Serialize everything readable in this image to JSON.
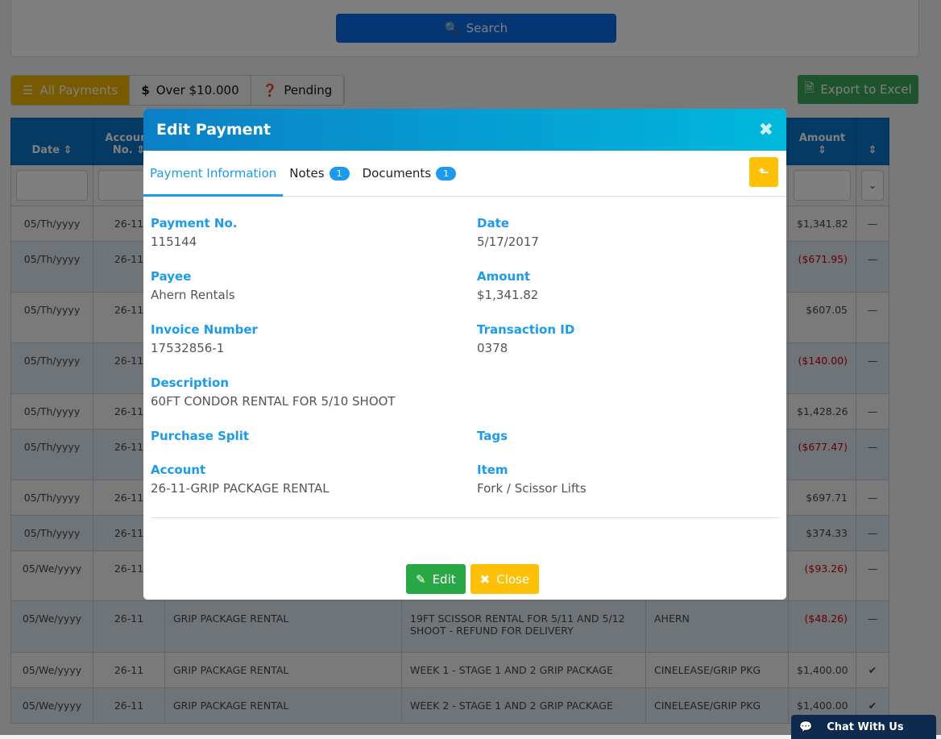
{
  "search": {
    "label": "Search"
  },
  "filters": [
    {
      "label": "All Payments",
      "icon": "list-icon"
    },
    {
      "label": "Over $10.000",
      "icon": "dollar-icon"
    },
    {
      "label": "Pending",
      "icon": "question-icon"
    }
  ],
  "export_label": "Export to Excel",
  "table": {
    "headers": {
      "date": "Date",
      "account": "Account No.",
      "amount": "Amount"
    },
    "rows": [
      {
        "date": "05/Th/yyyy",
        "acct": "26-11",
        "desc": "",
        "memo": "",
        "vendor": "",
        "amount": "$1,341.82",
        "neg": false,
        "status": "dash"
      },
      {
        "date": "05/Th/yyyy",
        "acct": "26-11",
        "desc": "",
        "memo": "",
        "vendor": "",
        "amount": "($671.95)",
        "neg": true,
        "status": "dash"
      },
      {
        "date": "05/Th/yyyy",
        "acct": "26-11",
        "desc": "",
        "memo": "",
        "vendor": "",
        "amount": "$607.05",
        "neg": false,
        "status": "dash"
      },
      {
        "date": "05/Th/yyyy",
        "acct": "26-11",
        "desc": "",
        "memo": "",
        "vendor": "",
        "amount": "($140.00)",
        "neg": true,
        "status": "dash"
      },
      {
        "date": "05/Th/yyyy",
        "acct": "26-11",
        "desc": "",
        "memo": "",
        "vendor": "",
        "amount": "$1,428.26",
        "neg": false,
        "status": "dash"
      },
      {
        "date": "05/Th/yyyy",
        "acct": "26-11",
        "desc": "",
        "memo": "",
        "vendor": "",
        "amount": "($677.47)",
        "neg": true,
        "status": "dash"
      },
      {
        "date": "05/Th/yyyy",
        "acct": "26-11",
        "desc": "",
        "memo": "",
        "vendor": "",
        "amount": "$697.71",
        "neg": false,
        "status": "dash"
      },
      {
        "date": "05/Th/yyyy",
        "acct": "26-11",
        "desc": "",
        "memo": "",
        "vendor": "",
        "amount": "$374.33",
        "neg": false,
        "status": "dash"
      },
      {
        "date": "05/We/yyyy",
        "acct": "26-11",
        "desc": "",
        "memo": "",
        "vendor": "",
        "amount": "($93.26)",
        "neg": true,
        "status": "dash"
      },
      {
        "date": "05/We/yyyy",
        "acct": "26-11",
        "desc": "GRIP PACKAGE RENTAL",
        "memo": "19FT SCISSOR RENTAL FOR 5/11 AND 5/12 SHOOT - REFUND FOR DELIVERY",
        "vendor": "AHERN",
        "amount": "($48.26)",
        "neg": true,
        "status": "dash"
      },
      {
        "date": "05/We/yyyy",
        "acct": "26-11",
        "desc": "GRIP PACKAGE RENTAL",
        "memo": "WEEK 1 - STAGE 1 AND 2 GRIP PACKAGE",
        "vendor": "CINELEASE/GRIP PKG",
        "amount": "$1,400.00",
        "neg": false,
        "status": "check"
      },
      {
        "date": "05/We/yyyy",
        "acct": "26-11",
        "desc": "GRIP PACKAGE RENTAL",
        "memo": "WEEK 2 - STAGE 1 AND 2 GRIP PACKAGE",
        "vendor": "CINELEASE/GRIP PKG",
        "amount": "$1,400.00",
        "neg": false,
        "status": "check"
      }
    ]
  },
  "modal": {
    "title": "Edit Payment",
    "tabs": [
      {
        "label": "Payment Information",
        "badge": null
      },
      {
        "label": "Notes",
        "badge": "1"
      },
      {
        "label": "Documents",
        "badge": "1"
      }
    ],
    "fields": {
      "payment_no": {
        "label": "Payment No.",
        "value": "115144"
      },
      "date": {
        "label": "Date",
        "value": "5/17/2017"
      },
      "payee": {
        "label": "Payee",
        "value": "Ahern Rentals"
      },
      "amount": {
        "label": "Amount",
        "value": "$1,341.82"
      },
      "invoice": {
        "label": "Invoice Number",
        "value": "17532856-1"
      },
      "txn": {
        "label": "Transaction ID",
        "value": "0378"
      },
      "description": {
        "label": "Description",
        "value": "60FT CONDOR RENTAL FOR 5/10 SHOOT"
      },
      "split": {
        "label": "Purchase Split",
        "value": ""
      },
      "tags": {
        "label": "Tags",
        "value": ""
      },
      "account": {
        "label": "Account",
        "value": "26-11-GRIP PACKAGE RENTAL"
      },
      "item": {
        "label": "Item",
        "value": "Fork / Scissor Lifts"
      }
    },
    "edit_label": "Edit",
    "close_label": "Close"
  },
  "chat_label": "Chat With Us"
}
